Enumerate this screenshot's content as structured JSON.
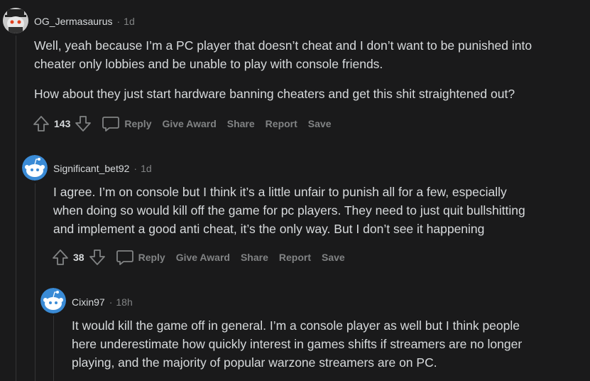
{
  "comments": [
    {
      "username": "OG_Jermasaurus",
      "separator": "·",
      "time": "1d",
      "paragraphs": [
        "Well, yeah because I’m a PC player that doesn’t cheat and I don’t want to be punished into\ncheater only lobbies and be unable to play with console friends.",
        "How about they just start hardware banning cheaters and get this shit straightened out?"
      ],
      "score": "143",
      "actions": {
        "reply": "Reply",
        "award": "Give Award",
        "share": "Share",
        "report": "Report",
        "save": "Save"
      }
    },
    {
      "username": "Significant_bet92",
      "separator": "·",
      "time": "1d",
      "paragraphs": [
        "I agree. I’m on console but I think it’s a little unfair to punish all for a few, especially\nwhen doing so would kill off the game for pc players. They need to just quit bullshitting\nand implement a good anti cheat, it’s the only way. But I don’t see it happening"
      ],
      "score": "38",
      "actions": {
        "reply": "Reply",
        "award": "Give Award",
        "share": "Share",
        "report": "Report",
        "save": "Save"
      }
    },
    {
      "username": "Cixin97",
      "separator": "·",
      "time": "18h",
      "paragraphs": [
        "It would kill the game off in general. I’m a console player as well but I think people\nhere underestimate how quickly interest in games shifts if streamers are no longer\nplaying, and the majority of popular warzone streamers are on PC."
      ]
    }
  ],
  "icons": {
    "upvote": "upvote-arrow-icon",
    "downvote": "downvote-arrow-icon",
    "reply": "speech-bubble-icon",
    "avatar_default": "snoo-avatar-icon"
  },
  "colors": {
    "background": "#1a1a1b",
    "text": "#d7dadc",
    "muted": "#818384",
    "thread_line": "#343536",
    "snoo_blue": "#3a8bd6"
  }
}
